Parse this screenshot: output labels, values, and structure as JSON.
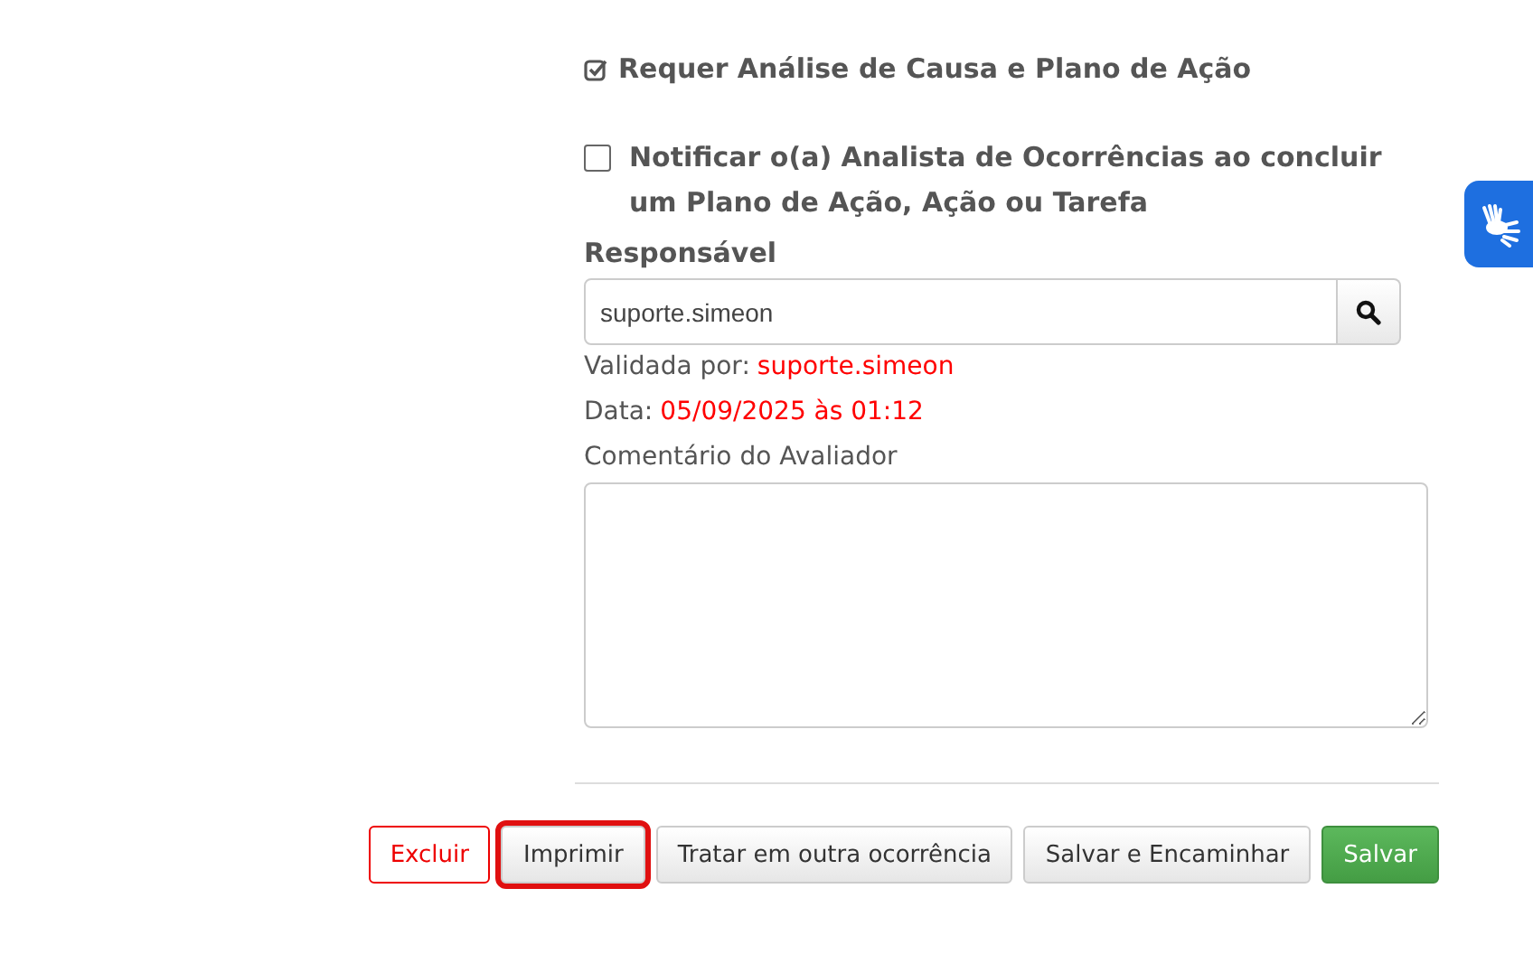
{
  "options": [
    {
      "label": "Requer Análise de Causa e Plano de Ação",
      "checked": true
    },
    {
      "label": "Notificar o(a) Analista de Ocorrências ao concluir um Plano de Ação, Ação ou Tarefa",
      "checked": false
    }
  ],
  "responsavel": {
    "label": "Responsável",
    "value": "suporte.simeon"
  },
  "validation": [
    {
      "label": "Validada por:",
      "value": "suporte.simeon"
    },
    {
      "label": "Data:",
      "value": "05/09/2025 às 01:12"
    }
  ],
  "comment": {
    "label": "Comentário do Avaliador"
  },
  "buttons": [
    {
      "label": "Excluir",
      "kind": "danger",
      "highlighted": false
    },
    {
      "label": "Imprimir",
      "kind": "default",
      "highlighted": true
    },
    {
      "label": "Tratar em outra ocorrência",
      "kind": "default",
      "highlighted": false
    },
    {
      "label": "Salvar e Encaminhar",
      "kind": "default",
      "highlighted": false
    },
    {
      "label": "Salvar",
      "kind": "success",
      "highlighted": false
    }
  ]
}
